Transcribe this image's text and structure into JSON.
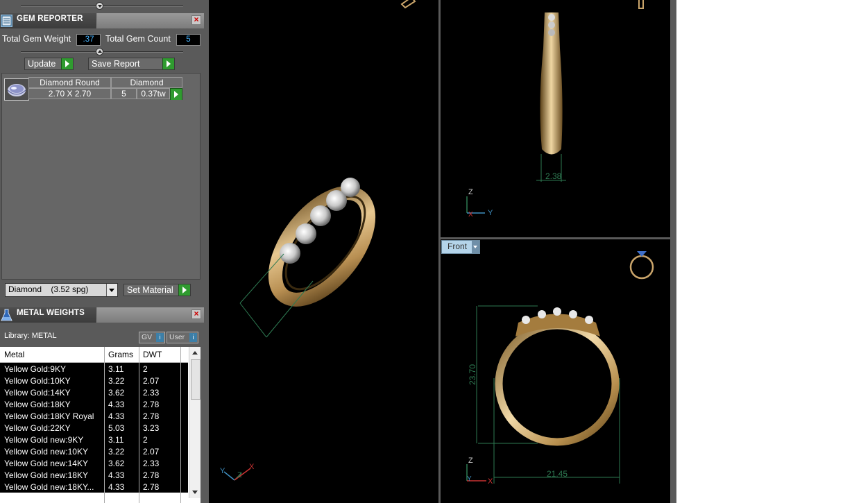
{
  "gem_reporter": {
    "title": "GEM REPORTER",
    "total_weight_label": "Total Gem Weight",
    "total_weight_value": ".37",
    "total_count_label": "Total Gem Count",
    "total_count_value": "5",
    "update_label": "Update",
    "save_report_label": "Save Report",
    "gem": {
      "shape": "Diamond Round",
      "material": "Diamond",
      "size": "2.70 X 2.70",
      "count": "5",
      "weight": "0.37tw"
    },
    "material_select": "Diamond    (3.52 spg)",
    "set_material_label": "Set Material"
  },
  "metal_weights": {
    "title": "METAL WEIGHTS",
    "library_label": "Library: METAL",
    "gv_label": "GV",
    "user_label": "User",
    "columns": [
      "Metal",
      "Grams",
      "DWT"
    ],
    "rows": [
      {
        "metal": "Yellow Gold:9KY",
        "grams": "3.11",
        "dwt": "2"
      },
      {
        "metal": "Yellow Gold:10KY",
        "grams": "3.22",
        "dwt": "2.07"
      },
      {
        "metal": "Yellow Gold:14KY",
        "grams": "3.62",
        "dwt": "2.33"
      },
      {
        "metal": "Yellow Gold:18KY",
        "grams": "4.33",
        "dwt": "2.78"
      },
      {
        "metal": "Yellow Gold:18KY Royal",
        "grams": "4.33",
        "dwt": "2.78"
      },
      {
        "metal": "Yellow Gold:22KY",
        "grams": "5.03",
        "dwt": "3.23"
      },
      {
        "metal": "Yellow Gold new:9KY",
        "grams": "3.11",
        "dwt": "2"
      },
      {
        "metal": "Yellow Gold new:10KY",
        "grams": "3.22",
        "dwt": "2.07"
      },
      {
        "metal": "Yellow Gold new:14KY",
        "grams": "3.62",
        "dwt": "2.33"
      },
      {
        "metal": "Yellow Gold new:18KY",
        "grams": "4.33",
        "dwt": "2.78"
      },
      {
        "metal": "Yellow Gold new:18KY...",
        "grams": "4.33",
        "dwt": "2.78"
      }
    ]
  },
  "viewports": {
    "side_dimension": "2.38",
    "front_tab": "Front",
    "front_height": "23.70",
    "front_width": "21.45",
    "axis_z": "Z",
    "axis_x": "X",
    "axis_y": "Y"
  },
  "colors": {
    "panel_bg": "#5a5a5a",
    "value_text": "#48b4ff",
    "go_button": "#2f9b2f",
    "dimension_line": "#2e7a52",
    "gold": "#c9a46a"
  }
}
